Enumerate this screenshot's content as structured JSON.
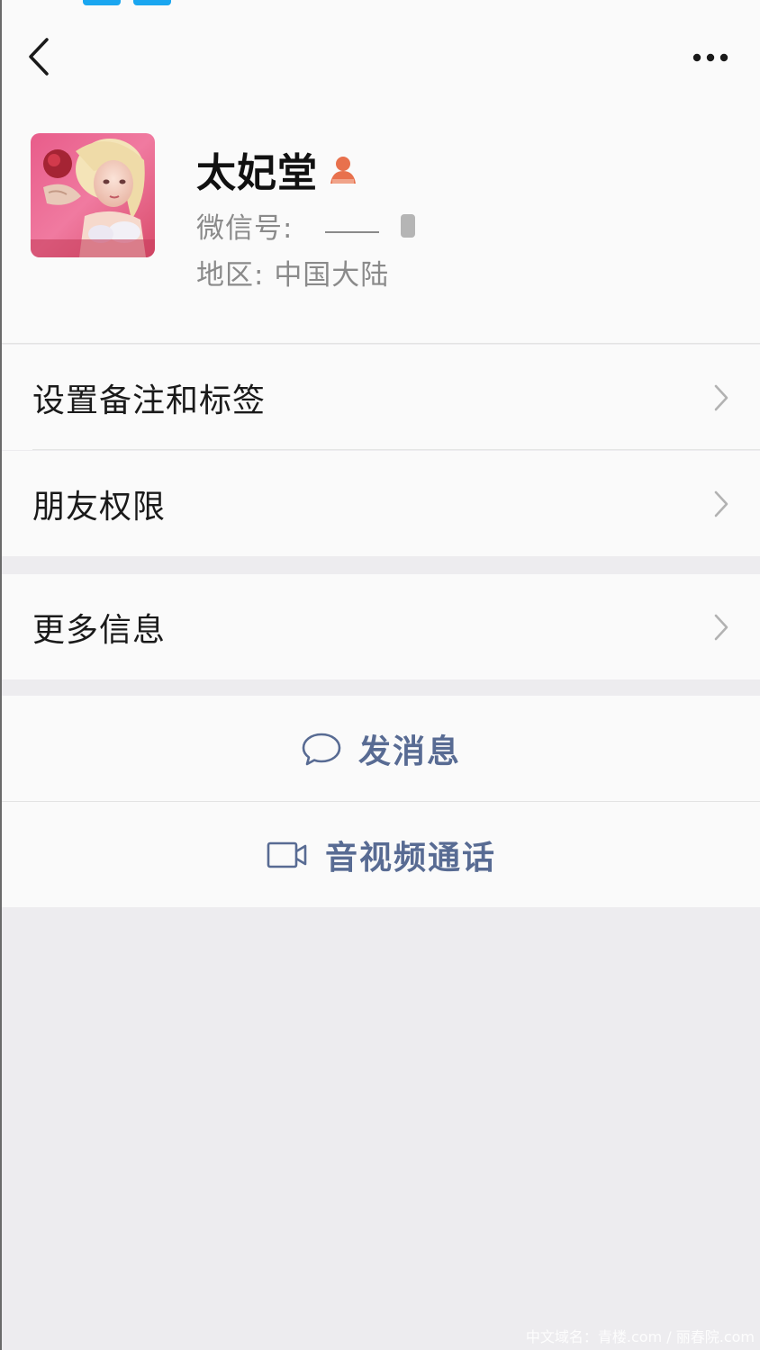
{
  "header": {
    "back_icon": "chevron-left-icon",
    "more_icon": "more-dots-icon"
  },
  "profile": {
    "nickname": "太妃堂",
    "gender_icon": "female-user-icon",
    "gender_color": "#e8714d",
    "wechat_id_label": "微信号:",
    "region_label": "地区:",
    "region_value": "中国大陆"
  },
  "menu": {
    "remark_label": "设置备注和标签",
    "permission_label": "朋友权限",
    "more_info_label": "更多信息"
  },
  "actions": {
    "message_label": "发消息",
    "message_icon": "chat-bubble-icon",
    "call_label": "音视频通话",
    "call_icon": "video-camera-icon",
    "accent_color": "#586b93"
  },
  "watermark": "中文域名：青楼.com / 丽春院.com"
}
